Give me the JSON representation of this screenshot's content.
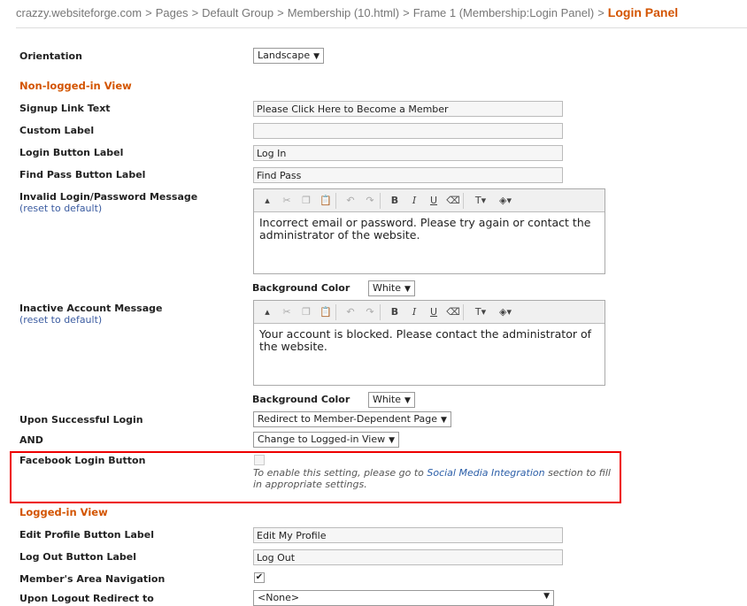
{
  "breadcrumb": {
    "items": [
      "crazzy.websiteforge.com",
      "Pages",
      "Default Group",
      "Membership (10.html)",
      "Frame 1 (Membership:Login Panel)"
    ],
    "separator": ">",
    "current": "Login Panel"
  },
  "fields": {
    "orientation": {
      "label": "Orientation",
      "value": "Landscape"
    },
    "non_logged_section": "Non-logged-in View",
    "signup_link": {
      "label": "Signup Link Text",
      "value": "Please Click Here to Become a Member"
    },
    "custom_label": {
      "label": "Custom Label",
      "value": ""
    },
    "login_button": {
      "label": "Login Button Label",
      "value": "Log In"
    },
    "find_pass": {
      "label": "Find Pass Button Label",
      "value": "Find Pass"
    },
    "invalid_msg": {
      "label": "Invalid Login/Password Message",
      "reset_open": "(",
      "reset": "reset to default",
      "reset_close": ")",
      "content": "Incorrect email or password. Please try again or contact the administrator of the website.",
      "bg_label": "Background Color",
      "bg_value": "White"
    },
    "inactive_msg": {
      "label": "Inactive Account Message",
      "reset_open": "(",
      "reset": "reset to default",
      "reset_close": ")",
      "content": "Your account is blocked. Please contact the administrator of the website.",
      "bg_label": "Background Color",
      "bg_value": "White"
    },
    "upon_success": {
      "label": "Upon Successful Login",
      "value": "Redirect to Member-Dependent Page"
    },
    "and": {
      "label": "AND",
      "value": "Change to Logged-in View"
    },
    "facebook": {
      "label": "Facebook Login Button",
      "checked": false,
      "note_before": "To enable this setting, please go to ",
      "note_link": "Social Media Integration",
      "note_after": " section to fill in appropriate settings."
    },
    "logged_section": "Logged-in View",
    "edit_profile": {
      "label": "Edit Profile Button Label",
      "value": "Edit My Profile"
    },
    "logout": {
      "label": "Log Out Button Label",
      "value": "Log Out"
    },
    "member_nav": {
      "label": "Member's Area Navigation",
      "checked": true,
      "check_glyph": "✔"
    },
    "logout_redirect": {
      "label": "Upon Logout Redirect to",
      "value": "<None>"
    }
  },
  "toolbar_icons": [
    "collapse-icon",
    "cut-icon",
    "copy-icon",
    "paste-icon",
    "undo-icon",
    "redo-icon",
    "bold-icon",
    "italic-icon",
    "underline-icon",
    "eraser-icon",
    "text-color-icon",
    "more-icon"
  ],
  "colors": {
    "accent": "#d35400",
    "link": "#2b5ea8",
    "highlight_box": "#e00000"
  }
}
